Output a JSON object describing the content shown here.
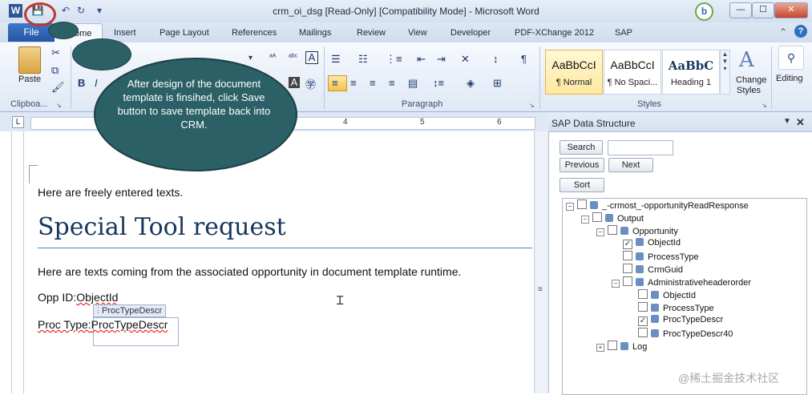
{
  "window": {
    "title": "crm_oi_dsg [Read-Only] [Compatibility Mode] - Microsoft Word",
    "minimize": "—",
    "maximize": "☐",
    "close": "✕"
  },
  "tabs": {
    "file": "File",
    "home": "ome",
    "insert": "Insert",
    "page_layout": "Page Layout",
    "references": "References",
    "mailings": "Mailings",
    "review": "Review",
    "view": "View",
    "developer": "Developer",
    "pdfxchange": "PDF-XChange 2012",
    "sap": "SAP"
  },
  "ribbon": {
    "paste": "Paste",
    "clipboard": "Clipboa...",
    "paragraph": "Paragraph",
    "styles_group": "Styles",
    "change_styles": "Change",
    "change_styles_2": "Styles",
    "editing": "Editing",
    "styles": [
      {
        "sample": "AaBbCcI",
        "name": "¶ Normal"
      },
      {
        "sample": "AaBbCcI",
        "name": "¶ No Spaci..."
      },
      {
        "sample": "AaBbC",
        "name": "Heading 1"
      }
    ]
  },
  "ruler": {
    "n4": "4",
    "n5": "5",
    "n6": "6"
  },
  "callout": {
    "text": "After design of the document template is finsihed, click Save button to save template back into CRM."
  },
  "document": {
    "line1": "Here are freely entered texts.",
    "heading": "Special Tool request",
    "line2": "Here are texts coming from the associated opportunity in document template runtime.",
    "opp_label": "Opp ID:",
    "opp_value": "ObjectId",
    "proc_label": "Proc Type:",
    "proc_value": "ProcTypeDescr",
    "cc_tag": "ProcTypeDescr"
  },
  "sap_pane": {
    "title": "SAP Data Structure",
    "search": "Search",
    "previous": "Previous",
    "next": "Next",
    "sort": "Sort",
    "tree": [
      {
        "label": "_-crmost_-opportunityReadResponse",
        "indent": 0,
        "exp": "−",
        "checked": false
      },
      {
        "label": "Output",
        "indent": 1,
        "exp": "−",
        "checked": false
      },
      {
        "label": "Opportunity",
        "indent": 2,
        "exp": "−",
        "checked": false
      },
      {
        "label": "ObjectId",
        "indent": 3,
        "exp": "",
        "checked": true
      },
      {
        "label": "ProcessType",
        "indent": 3,
        "exp": "",
        "checked": false
      },
      {
        "label": "CrmGuid",
        "indent": 3,
        "exp": "",
        "checked": false
      },
      {
        "label": "Administrativeheaderorder",
        "indent": 3,
        "exp": "−",
        "checked": false
      },
      {
        "label": "ObjectId",
        "indent": 4,
        "exp": "",
        "checked": false
      },
      {
        "label": "ProcessType",
        "indent": 4,
        "exp": "",
        "checked": false
      },
      {
        "label": "ProcTypeDescr",
        "indent": 4,
        "exp": "",
        "checked": true
      },
      {
        "label": "ProcTypeDescr40",
        "indent": 4,
        "exp": "",
        "checked": false
      },
      {
        "label": "Log",
        "indent": 2,
        "exp": "+",
        "checked": false
      }
    ]
  },
  "watermark": "@稀土掘金技术社区",
  "colors": {
    "callout": "#2a6066",
    "save_highlight": "#c0392b",
    "heading": "#17365d"
  }
}
